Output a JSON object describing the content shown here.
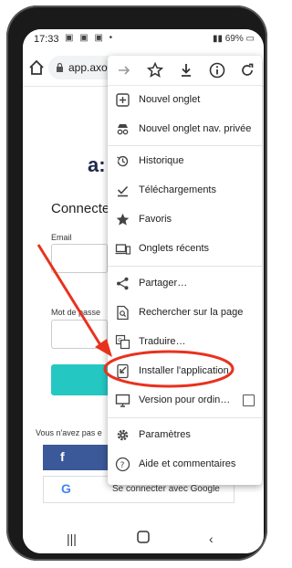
{
  "status_bar": {
    "time": "17:33",
    "battery": "69%"
  },
  "browser": {
    "url": "app.axon"
  },
  "page": {
    "logo_text": "a:",
    "heading": "Connecte",
    "email_label": "Email",
    "password_label": "Mot de passe",
    "no_account": "Vous n'avez pas e",
    "facebook_letter": "f",
    "google_letter": "G",
    "google_button": "Se connecter avec Google"
  },
  "menu": {
    "items": [
      {
        "label": "Nouvel onglet",
        "icon": "plus-square-icon"
      },
      {
        "label": "Nouvel onglet nav. privée",
        "icon": "incognito-icon"
      },
      {
        "label": "Historique",
        "icon": "history-icon"
      },
      {
        "label": "Téléchargements",
        "icon": "downloads-icon"
      },
      {
        "label": "Favoris",
        "icon": "star-icon"
      },
      {
        "label": "Onglets récents",
        "icon": "devices-icon"
      },
      {
        "label": "Partager…",
        "icon": "share-icon"
      },
      {
        "label": "Rechercher sur la page",
        "icon": "find-in-page-icon"
      },
      {
        "label": "Traduire…",
        "icon": "translate-icon"
      },
      {
        "label": "Installer l'application",
        "icon": "install-app-icon"
      },
      {
        "label": "Version pour ordin…",
        "icon": "desktop-icon"
      },
      {
        "label": "Paramètres",
        "icon": "gear-icon"
      },
      {
        "label": "Aide et commentaires",
        "icon": "help-icon"
      }
    ]
  },
  "colors": {
    "annotation": "#e8321e",
    "teal_button": "#25c7c3",
    "facebook": "#3b5998"
  }
}
